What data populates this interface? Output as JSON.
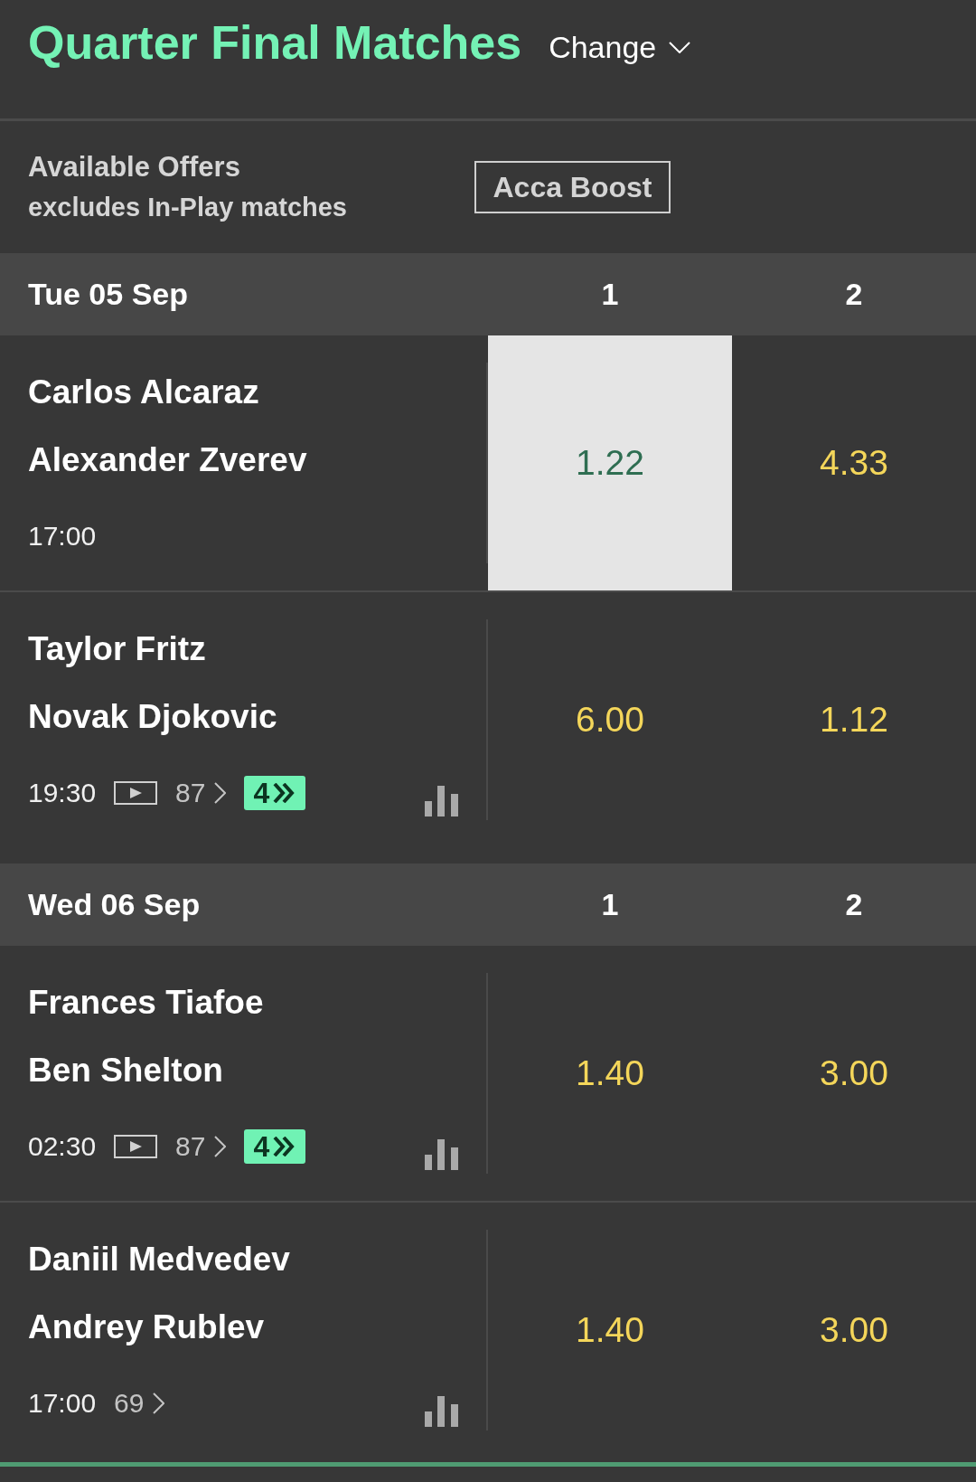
{
  "header": {
    "title": "Quarter Final Matches",
    "change_label": "Change"
  },
  "offers": {
    "title": "Available Offers",
    "subtitle": "excludes In-Play matches",
    "button": "Acca Boost"
  },
  "days": [
    {
      "date": "Tue 05 Sep",
      "columns": [
        "1",
        "2"
      ],
      "matches": [
        {
          "players": [
            "Carlos Alcaraz",
            "Alexander Zverev"
          ],
          "time": "17:00",
          "live_stream": false,
          "stats": false,
          "odds": [
            {
              "value": "1.22",
              "selected": true
            },
            {
              "value": "4.33",
              "selected": false
            }
          ]
        },
        {
          "players": [
            "Taylor Fritz",
            "Novak Djokovic"
          ],
          "time": "19:30",
          "live_stream": true,
          "markets": "87",
          "boost": "4",
          "stats": true,
          "odds": [
            {
              "value": "6.00",
              "selected": false
            },
            {
              "value": "1.12",
              "selected": false
            }
          ]
        }
      ]
    },
    {
      "date": "Wed 06 Sep",
      "columns": [
        "1",
        "2"
      ],
      "matches": [
        {
          "players": [
            "Frances Tiafoe",
            "Ben Shelton"
          ],
          "time": "02:30",
          "live_stream": true,
          "markets": "87",
          "boost": "4",
          "stats": true,
          "odds": [
            {
              "value": "1.40",
              "selected": false
            },
            {
              "value": "3.00",
              "selected": false
            }
          ]
        },
        {
          "players": [
            "Daniil Medvedev",
            "Andrey Rublev"
          ],
          "time": "17:00",
          "live_stream": false,
          "markets": "69",
          "stats": true,
          "odds": [
            {
              "value": "1.40",
              "selected": false
            },
            {
              "value": "3.00",
              "selected": false
            }
          ]
        }
      ]
    }
  ]
}
